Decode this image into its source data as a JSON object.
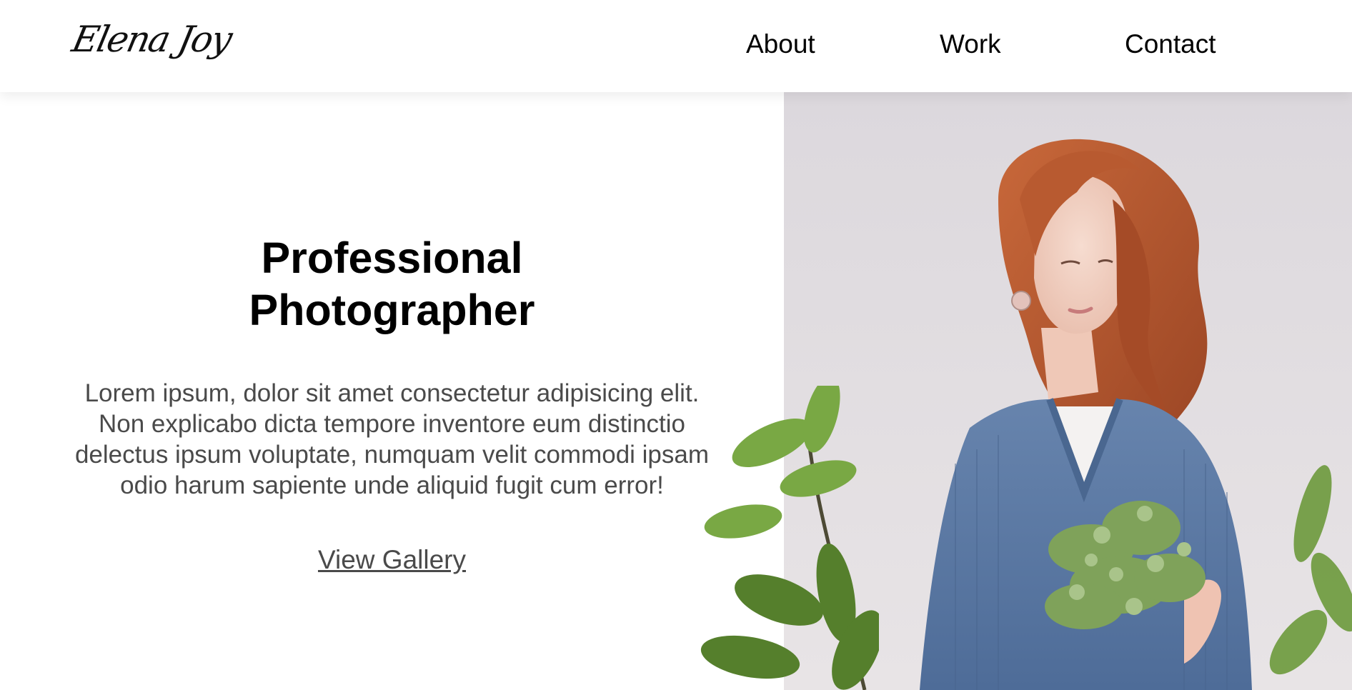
{
  "header": {
    "logo": "Elena Joy",
    "nav": [
      {
        "label": "About"
      },
      {
        "label": "Work"
      },
      {
        "label": "Contact"
      }
    ]
  },
  "hero": {
    "title": "Professional\nPhotographer",
    "body": "Lorem ipsum, dolor sit amet consectetur adipisicing elit.\nNon explicabo dicta tempore inventore eum distinctio\ndelectus ipsum voluptate, numquam velit commodi ipsam\nodio harum sapiente unde aliquid fugit cum error!",
    "link_label": "View Gallery"
  },
  "photo": {
    "subject": "woman-holding-plants",
    "colors": {
      "background": "#dcd8dd",
      "hair": "#b5532c",
      "sweater": "#5878a4",
      "leaves": "#6f9a3d"
    }
  }
}
